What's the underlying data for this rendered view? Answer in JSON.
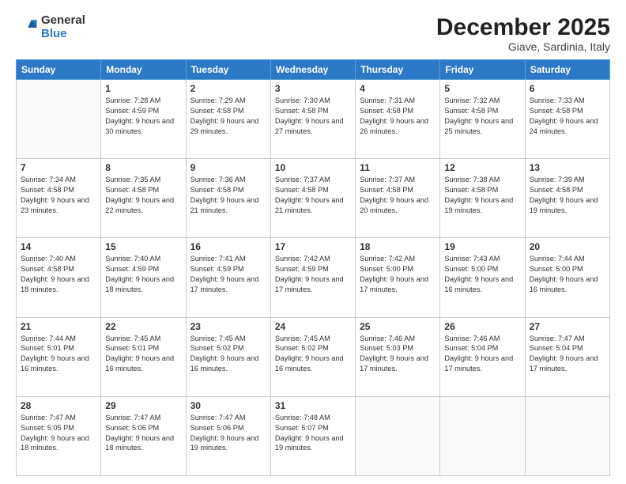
{
  "logo": {
    "general": "General",
    "blue": "Blue"
  },
  "title": {
    "month": "December 2025",
    "location": "Giave, Sardinia, Italy"
  },
  "headers": [
    "Sunday",
    "Monday",
    "Tuesday",
    "Wednesday",
    "Thursday",
    "Friday",
    "Saturday"
  ],
  "weeks": [
    [
      {
        "day": "",
        "sunrise": "",
        "sunset": "",
        "daylight": "",
        "empty": true
      },
      {
        "day": "1",
        "sunrise": "Sunrise: 7:28 AM",
        "sunset": "Sunset: 4:59 PM",
        "daylight": "Daylight: 9 hours and 30 minutes."
      },
      {
        "day": "2",
        "sunrise": "Sunrise: 7:29 AM",
        "sunset": "Sunset: 4:58 PM",
        "daylight": "Daylight: 9 hours and 29 minutes."
      },
      {
        "day": "3",
        "sunrise": "Sunrise: 7:30 AM",
        "sunset": "Sunset: 4:58 PM",
        "daylight": "Daylight: 9 hours and 27 minutes."
      },
      {
        "day": "4",
        "sunrise": "Sunrise: 7:31 AM",
        "sunset": "Sunset: 4:58 PM",
        "daylight": "Daylight: 9 hours and 26 minutes."
      },
      {
        "day": "5",
        "sunrise": "Sunrise: 7:32 AM",
        "sunset": "Sunset: 4:58 PM",
        "daylight": "Daylight: 9 hours and 25 minutes."
      },
      {
        "day": "6",
        "sunrise": "Sunrise: 7:33 AM",
        "sunset": "Sunset: 4:58 PM",
        "daylight": "Daylight: 9 hours and 24 minutes."
      }
    ],
    [
      {
        "day": "7",
        "sunrise": "Sunrise: 7:34 AM",
        "sunset": "Sunset: 4:58 PM",
        "daylight": "Daylight: 9 hours and 23 minutes."
      },
      {
        "day": "8",
        "sunrise": "Sunrise: 7:35 AM",
        "sunset": "Sunset: 4:58 PM",
        "daylight": "Daylight: 9 hours and 22 minutes."
      },
      {
        "day": "9",
        "sunrise": "Sunrise: 7:36 AM",
        "sunset": "Sunset: 4:58 PM",
        "daylight": "Daylight: 9 hours and 21 minutes."
      },
      {
        "day": "10",
        "sunrise": "Sunrise: 7:37 AM",
        "sunset": "Sunset: 4:58 PM",
        "daylight": "Daylight: 9 hours and 21 minutes."
      },
      {
        "day": "11",
        "sunrise": "Sunrise: 7:37 AM",
        "sunset": "Sunset: 4:58 PM",
        "daylight": "Daylight: 9 hours and 20 minutes."
      },
      {
        "day": "12",
        "sunrise": "Sunrise: 7:38 AM",
        "sunset": "Sunset: 4:58 PM",
        "daylight": "Daylight: 9 hours and 19 minutes."
      },
      {
        "day": "13",
        "sunrise": "Sunrise: 7:39 AM",
        "sunset": "Sunset: 4:58 PM",
        "daylight": "Daylight: 9 hours and 19 minutes."
      }
    ],
    [
      {
        "day": "14",
        "sunrise": "Sunrise: 7:40 AM",
        "sunset": "Sunset: 4:58 PM",
        "daylight": "Daylight: 9 hours and 18 minutes."
      },
      {
        "day": "15",
        "sunrise": "Sunrise: 7:40 AM",
        "sunset": "Sunset: 4:59 PM",
        "daylight": "Daylight: 9 hours and 18 minutes."
      },
      {
        "day": "16",
        "sunrise": "Sunrise: 7:41 AM",
        "sunset": "Sunset: 4:59 PM",
        "daylight": "Daylight: 9 hours and 17 minutes."
      },
      {
        "day": "17",
        "sunrise": "Sunrise: 7:42 AM",
        "sunset": "Sunset: 4:59 PM",
        "daylight": "Daylight: 9 hours and 17 minutes."
      },
      {
        "day": "18",
        "sunrise": "Sunrise: 7:42 AM",
        "sunset": "Sunset: 5:00 PM",
        "daylight": "Daylight: 9 hours and 17 minutes."
      },
      {
        "day": "19",
        "sunrise": "Sunrise: 7:43 AM",
        "sunset": "Sunset: 5:00 PM",
        "daylight": "Daylight: 9 hours and 16 minutes."
      },
      {
        "day": "20",
        "sunrise": "Sunrise: 7:44 AM",
        "sunset": "Sunset: 5:00 PM",
        "daylight": "Daylight: 9 hours and 16 minutes."
      }
    ],
    [
      {
        "day": "21",
        "sunrise": "Sunrise: 7:44 AM",
        "sunset": "Sunset: 5:01 PM",
        "daylight": "Daylight: 9 hours and 16 minutes."
      },
      {
        "day": "22",
        "sunrise": "Sunrise: 7:45 AM",
        "sunset": "Sunset: 5:01 PM",
        "daylight": "Daylight: 9 hours and 16 minutes."
      },
      {
        "day": "23",
        "sunrise": "Sunrise: 7:45 AM",
        "sunset": "Sunset: 5:02 PM",
        "daylight": "Daylight: 9 hours and 16 minutes."
      },
      {
        "day": "24",
        "sunrise": "Sunrise: 7:45 AM",
        "sunset": "Sunset: 5:02 PM",
        "daylight": "Daylight: 9 hours and 16 minutes."
      },
      {
        "day": "25",
        "sunrise": "Sunrise: 7:46 AM",
        "sunset": "Sunset: 5:03 PM",
        "daylight": "Daylight: 9 hours and 17 minutes."
      },
      {
        "day": "26",
        "sunrise": "Sunrise: 7:46 AM",
        "sunset": "Sunset: 5:04 PM",
        "daylight": "Daylight: 9 hours and 17 minutes."
      },
      {
        "day": "27",
        "sunrise": "Sunrise: 7:47 AM",
        "sunset": "Sunset: 5:04 PM",
        "daylight": "Daylight: 9 hours and 17 minutes."
      }
    ],
    [
      {
        "day": "28",
        "sunrise": "Sunrise: 7:47 AM",
        "sunset": "Sunset: 5:05 PM",
        "daylight": "Daylight: 9 hours and 18 minutes."
      },
      {
        "day": "29",
        "sunrise": "Sunrise: 7:47 AM",
        "sunset": "Sunset: 5:06 PM",
        "daylight": "Daylight: 9 hours and 18 minutes."
      },
      {
        "day": "30",
        "sunrise": "Sunrise: 7:47 AM",
        "sunset": "Sunset: 5:06 PM",
        "daylight": "Daylight: 9 hours and 19 minutes."
      },
      {
        "day": "31",
        "sunrise": "Sunrise: 7:48 AM",
        "sunset": "Sunset: 5:07 PM",
        "daylight": "Daylight: 9 hours and 19 minutes."
      },
      {
        "day": "",
        "sunrise": "",
        "sunset": "",
        "daylight": "",
        "empty": true
      },
      {
        "day": "",
        "sunrise": "",
        "sunset": "",
        "daylight": "",
        "empty": true
      },
      {
        "day": "",
        "sunrise": "",
        "sunset": "",
        "daylight": "",
        "empty": true
      }
    ]
  ]
}
